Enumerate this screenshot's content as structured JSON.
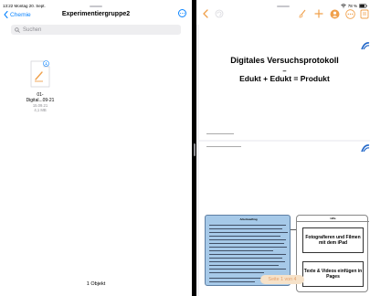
{
  "status": {
    "time_date": "13:22  Montag 20. Sept.",
    "battery": "78 %"
  },
  "files": {
    "back_label": "Chemie",
    "title": "Experimentiergruppe2",
    "search_placeholder": "Suchen",
    "item": {
      "name_line1": "01-",
      "name_line2": "Digital...09-21",
      "date": "15.09.21",
      "size": "4,1 MB"
    },
    "count": "1 Objekt"
  },
  "document": {
    "page1": {
      "title_line1": "Digitales Versuchsprotokoll",
      "title_line2": "–",
      "title_line3": "Edukt + Edukt = Produkt"
    },
    "page2": {
      "blue_box_title": "Arbeitsauftrag",
      "right_box_title": "Hilfe",
      "help_item1": "Fotografieren und Filmen mit dem iPad",
      "help_item2": "Texte & Videos einfügen in Pages"
    },
    "page_indicator": "Seite 1 von 4"
  },
  "colors": {
    "ios_blue": "#0a84ff",
    "pages_orange": "#f0a04b",
    "task_box": "#a6c9e8"
  },
  "icons": [
    "chevron-left-icon",
    "search-icon",
    "ellipsis-circle-icon",
    "document-icon",
    "undo-icon",
    "paintbrush-icon",
    "plus-icon",
    "collaborate-icon",
    "more-icon",
    "document-view-icon",
    "wifi-icon",
    "battery-icon"
  ]
}
